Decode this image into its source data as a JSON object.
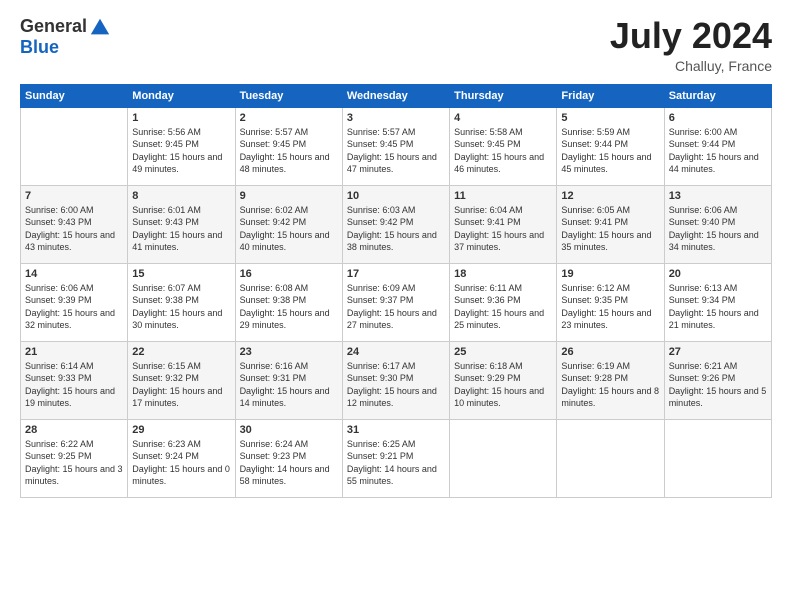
{
  "header": {
    "logo_general": "General",
    "logo_blue": "Blue",
    "month_year": "July 2024",
    "location": "Challuy, France"
  },
  "days_of_week": [
    "Sunday",
    "Monday",
    "Tuesday",
    "Wednesday",
    "Thursday",
    "Friday",
    "Saturday"
  ],
  "weeks": [
    [
      {
        "day": "",
        "sunrise": "",
        "sunset": "",
        "daylight": ""
      },
      {
        "day": "1",
        "sunrise": "Sunrise: 5:56 AM",
        "sunset": "Sunset: 9:45 PM",
        "daylight": "Daylight: 15 hours and 49 minutes."
      },
      {
        "day": "2",
        "sunrise": "Sunrise: 5:57 AM",
        "sunset": "Sunset: 9:45 PM",
        "daylight": "Daylight: 15 hours and 48 minutes."
      },
      {
        "day": "3",
        "sunrise": "Sunrise: 5:57 AM",
        "sunset": "Sunset: 9:45 PM",
        "daylight": "Daylight: 15 hours and 47 minutes."
      },
      {
        "day": "4",
        "sunrise": "Sunrise: 5:58 AM",
        "sunset": "Sunset: 9:45 PM",
        "daylight": "Daylight: 15 hours and 46 minutes."
      },
      {
        "day": "5",
        "sunrise": "Sunrise: 5:59 AM",
        "sunset": "Sunset: 9:44 PM",
        "daylight": "Daylight: 15 hours and 45 minutes."
      },
      {
        "day": "6",
        "sunrise": "Sunrise: 6:00 AM",
        "sunset": "Sunset: 9:44 PM",
        "daylight": "Daylight: 15 hours and 44 minutes."
      }
    ],
    [
      {
        "day": "7",
        "sunrise": "Sunrise: 6:00 AM",
        "sunset": "Sunset: 9:43 PM",
        "daylight": "Daylight: 15 hours and 43 minutes."
      },
      {
        "day": "8",
        "sunrise": "Sunrise: 6:01 AM",
        "sunset": "Sunset: 9:43 PM",
        "daylight": "Daylight: 15 hours and 41 minutes."
      },
      {
        "day": "9",
        "sunrise": "Sunrise: 6:02 AM",
        "sunset": "Sunset: 9:42 PM",
        "daylight": "Daylight: 15 hours and 40 minutes."
      },
      {
        "day": "10",
        "sunrise": "Sunrise: 6:03 AM",
        "sunset": "Sunset: 9:42 PM",
        "daylight": "Daylight: 15 hours and 38 minutes."
      },
      {
        "day": "11",
        "sunrise": "Sunrise: 6:04 AM",
        "sunset": "Sunset: 9:41 PM",
        "daylight": "Daylight: 15 hours and 37 minutes."
      },
      {
        "day": "12",
        "sunrise": "Sunrise: 6:05 AM",
        "sunset": "Sunset: 9:41 PM",
        "daylight": "Daylight: 15 hours and 35 minutes."
      },
      {
        "day": "13",
        "sunrise": "Sunrise: 6:06 AM",
        "sunset": "Sunset: 9:40 PM",
        "daylight": "Daylight: 15 hours and 34 minutes."
      }
    ],
    [
      {
        "day": "14",
        "sunrise": "Sunrise: 6:06 AM",
        "sunset": "Sunset: 9:39 PM",
        "daylight": "Daylight: 15 hours and 32 minutes."
      },
      {
        "day": "15",
        "sunrise": "Sunrise: 6:07 AM",
        "sunset": "Sunset: 9:38 PM",
        "daylight": "Daylight: 15 hours and 30 minutes."
      },
      {
        "day": "16",
        "sunrise": "Sunrise: 6:08 AM",
        "sunset": "Sunset: 9:38 PM",
        "daylight": "Daylight: 15 hours and 29 minutes."
      },
      {
        "day": "17",
        "sunrise": "Sunrise: 6:09 AM",
        "sunset": "Sunset: 9:37 PM",
        "daylight": "Daylight: 15 hours and 27 minutes."
      },
      {
        "day": "18",
        "sunrise": "Sunrise: 6:11 AM",
        "sunset": "Sunset: 9:36 PM",
        "daylight": "Daylight: 15 hours and 25 minutes."
      },
      {
        "day": "19",
        "sunrise": "Sunrise: 6:12 AM",
        "sunset": "Sunset: 9:35 PM",
        "daylight": "Daylight: 15 hours and 23 minutes."
      },
      {
        "day": "20",
        "sunrise": "Sunrise: 6:13 AM",
        "sunset": "Sunset: 9:34 PM",
        "daylight": "Daylight: 15 hours and 21 minutes."
      }
    ],
    [
      {
        "day": "21",
        "sunrise": "Sunrise: 6:14 AM",
        "sunset": "Sunset: 9:33 PM",
        "daylight": "Daylight: 15 hours and 19 minutes."
      },
      {
        "day": "22",
        "sunrise": "Sunrise: 6:15 AM",
        "sunset": "Sunset: 9:32 PM",
        "daylight": "Daylight: 15 hours and 17 minutes."
      },
      {
        "day": "23",
        "sunrise": "Sunrise: 6:16 AM",
        "sunset": "Sunset: 9:31 PM",
        "daylight": "Daylight: 15 hours and 14 minutes."
      },
      {
        "day": "24",
        "sunrise": "Sunrise: 6:17 AM",
        "sunset": "Sunset: 9:30 PM",
        "daylight": "Daylight: 15 hours and 12 minutes."
      },
      {
        "day": "25",
        "sunrise": "Sunrise: 6:18 AM",
        "sunset": "Sunset: 9:29 PM",
        "daylight": "Daylight: 15 hours and 10 minutes."
      },
      {
        "day": "26",
        "sunrise": "Sunrise: 6:19 AM",
        "sunset": "Sunset: 9:28 PM",
        "daylight": "Daylight: 15 hours and 8 minutes."
      },
      {
        "day": "27",
        "sunrise": "Sunrise: 6:21 AM",
        "sunset": "Sunset: 9:26 PM",
        "daylight": "Daylight: 15 hours and 5 minutes."
      }
    ],
    [
      {
        "day": "28",
        "sunrise": "Sunrise: 6:22 AM",
        "sunset": "Sunset: 9:25 PM",
        "daylight": "Daylight: 15 hours and 3 minutes."
      },
      {
        "day": "29",
        "sunrise": "Sunrise: 6:23 AM",
        "sunset": "Sunset: 9:24 PM",
        "daylight": "Daylight: 15 hours and 0 minutes."
      },
      {
        "day": "30",
        "sunrise": "Sunrise: 6:24 AM",
        "sunset": "Sunset: 9:23 PM",
        "daylight": "Daylight: 14 hours and 58 minutes."
      },
      {
        "day": "31",
        "sunrise": "Sunrise: 6:25 AM",
        "sunset": "Sunset: 9:21 PM",
        "daylight": "Daylight: 14 hours and 55 minutes."
      },
      {
        "day": "",
        "sunrise": "",
        "sunset": "",
        "daylight": ""
      },
      {
        "day": "",
        "sunrise": "",
        "sunset": "",
        "daylight": ""
      },
      {
        "day": "",
        "sunrise": "",
        "sunset": "",
        "daylight": ""
      }
    ]
  ]
}
